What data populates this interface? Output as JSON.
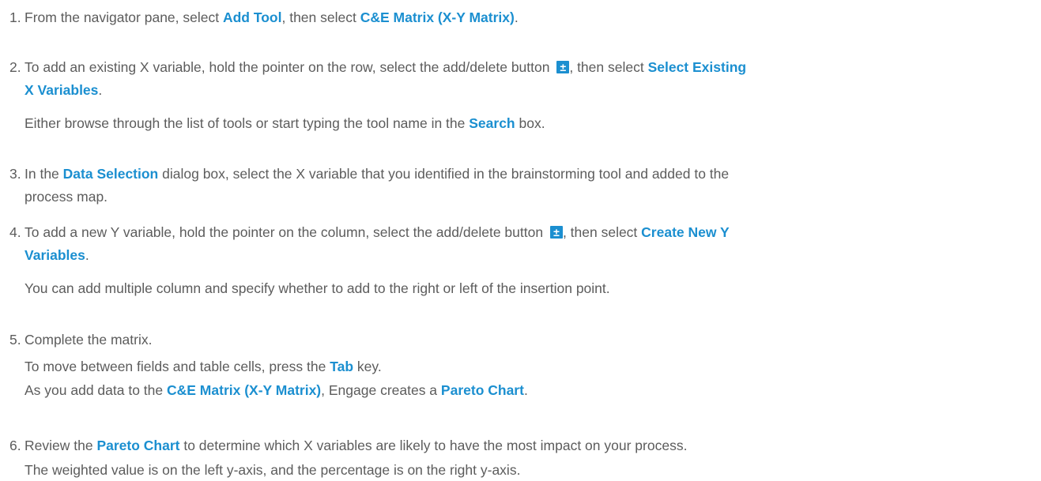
{
  "colors": {
    "text": "#5c5c5c",
    "link": "#1b8fd0",
    "icon_bg": "#1b8fd0"
  },
  "icons": {
    "add_delete": "plus-minus-icon",
    "add_delete_glyph": "±"
  },
  "steps": [
    {
      "number": "1.",
      "lines": [
        {
          "t1": "From the navigator pane, select ",
          "b1": "Add Tool",
          "t2": ", then select ",
          "b2": "C&E Matrix (X-Y Matrix)",
          "t3": "."
        }
      ]
    },
    {
      "number": "2.",
      "lines": [
        {
          "t1": "To add an existing X variable, hold the pointer on the row, select the add/delete button ",
          "t2": ", then select ",
          "b1": "Select Existing"
        },
        {
          "b1": "X Variables",
          "t1": "."
        },
        {
          "t1": "Either browse through the list of tools or start typing the tool name in the ",
          "b1": "Search",
          "t2": " box."
        }
      ]
    },
    {
      "number": "3.",
      "lines": [
        {
          "t1": "In the ",
          "b1": "Data Selection",
          "t2": " dialog box, select the X variable that you identified in the brainstorming tool and added to the"
        },
        {
          "t1": "process map."
        }
      ]
    },
    {
      "number": "4.",
      "lines": [
        {
          "t1": "To add a new Y variable, hold the pointer on the column, select the add/delete button ",
          "t2": ", then select ",
          "b1": "Create New Y"
        },
        {
          "b1": "Variables",
          "t1": "."
        },
        {
          "t1": "You can add multiple column and specify whether to add to the right or left of the insertion point."
        }
      ]
    },
    {
      "number": "5.",
      "lines": [
        {
          "t1": "Complete the matrix."
        },
        {
          "t1": "To move between fields and table cells, press the ",
          "b1": "Tab",
          "t2": " key."
        },
        {
          "t1": "As you add data to the ",
          "b1": "C&E Matrix (X-Y Matrix)",
          "t2": ", Engage creates a ",
          "b2": "Pareto Chart",
          "t3": "."
        }
      ]
    },
    {
      "number": "6.",
      "lines": [
        {
          "t1": "Review the ",
          "b1": "Pareto Chart",
          "t2": " to determine which X variables are likely to have the most impact on your process."
        },
        {
          "t1": "The weighted value is on the left y-axis, and the percentage is on the right y-axis."
        }
      ]
    }
  ]
}
